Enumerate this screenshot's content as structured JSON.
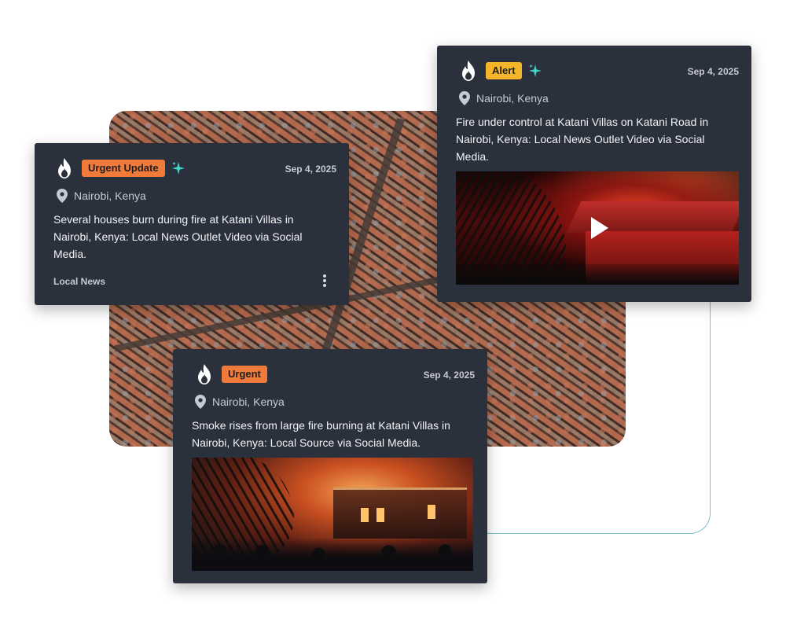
{
  "colors": {
    "card_bg": "#2b303d",
    "badge_orange": "#f07a3a",
    "badge_yellow": "#f5b52a",
    "sparkle_teal": "#3fd6c3",
    "connector": "#79c3c7"
  },
  "cards": [
    {
      "badge": "Urgent Update",
      "badge_color": "#f07a3a",
      "date": "Sep 4, 2025",
      "location": "Nairobi, Kenya",
      "description": "Several houses burn during fire at Katani Villas in Nairobi, Kenya: Local News Outlet Video via Social Media.",
      "source": "Local News",
      "icons": [
        "flame-icon",
        "sparkle-icon",
        "location-pin-icon",
        "more-vertical-icon"
      ]
    },
    {
      "badge": "Alert",
      "badge_color": "#f5b52a",
      "date": "Sep 4, 2025",
      "location": "Nairobi, Kenya",
      "description": "Fire under control at Katani Villas on Katani Road in Nairobi, Kenya: Local News Outlet Video via Social Media.",
      "media": "video-thumbnail",
      "icons": [
        "flame-icon",
        "sparkle-icon",
        "location-pin-icon",
        "play-icon"
      ]
    },
    {
      "badge": "Urgent",
      "badge_color": "#f07a3a",
      "date": "Sep 4, 2025",
      "location": "Nairobi, Kenya",
      "description": "Smoke rises from large fire burning at Katani Villas in Nairobi, Kenya: Local Source via Social Media.",
      "media": "image-thumbnail",
      "icons": [
        "flame-icon",
        "location-pin-icon"
      ]
    }
  ]
}
